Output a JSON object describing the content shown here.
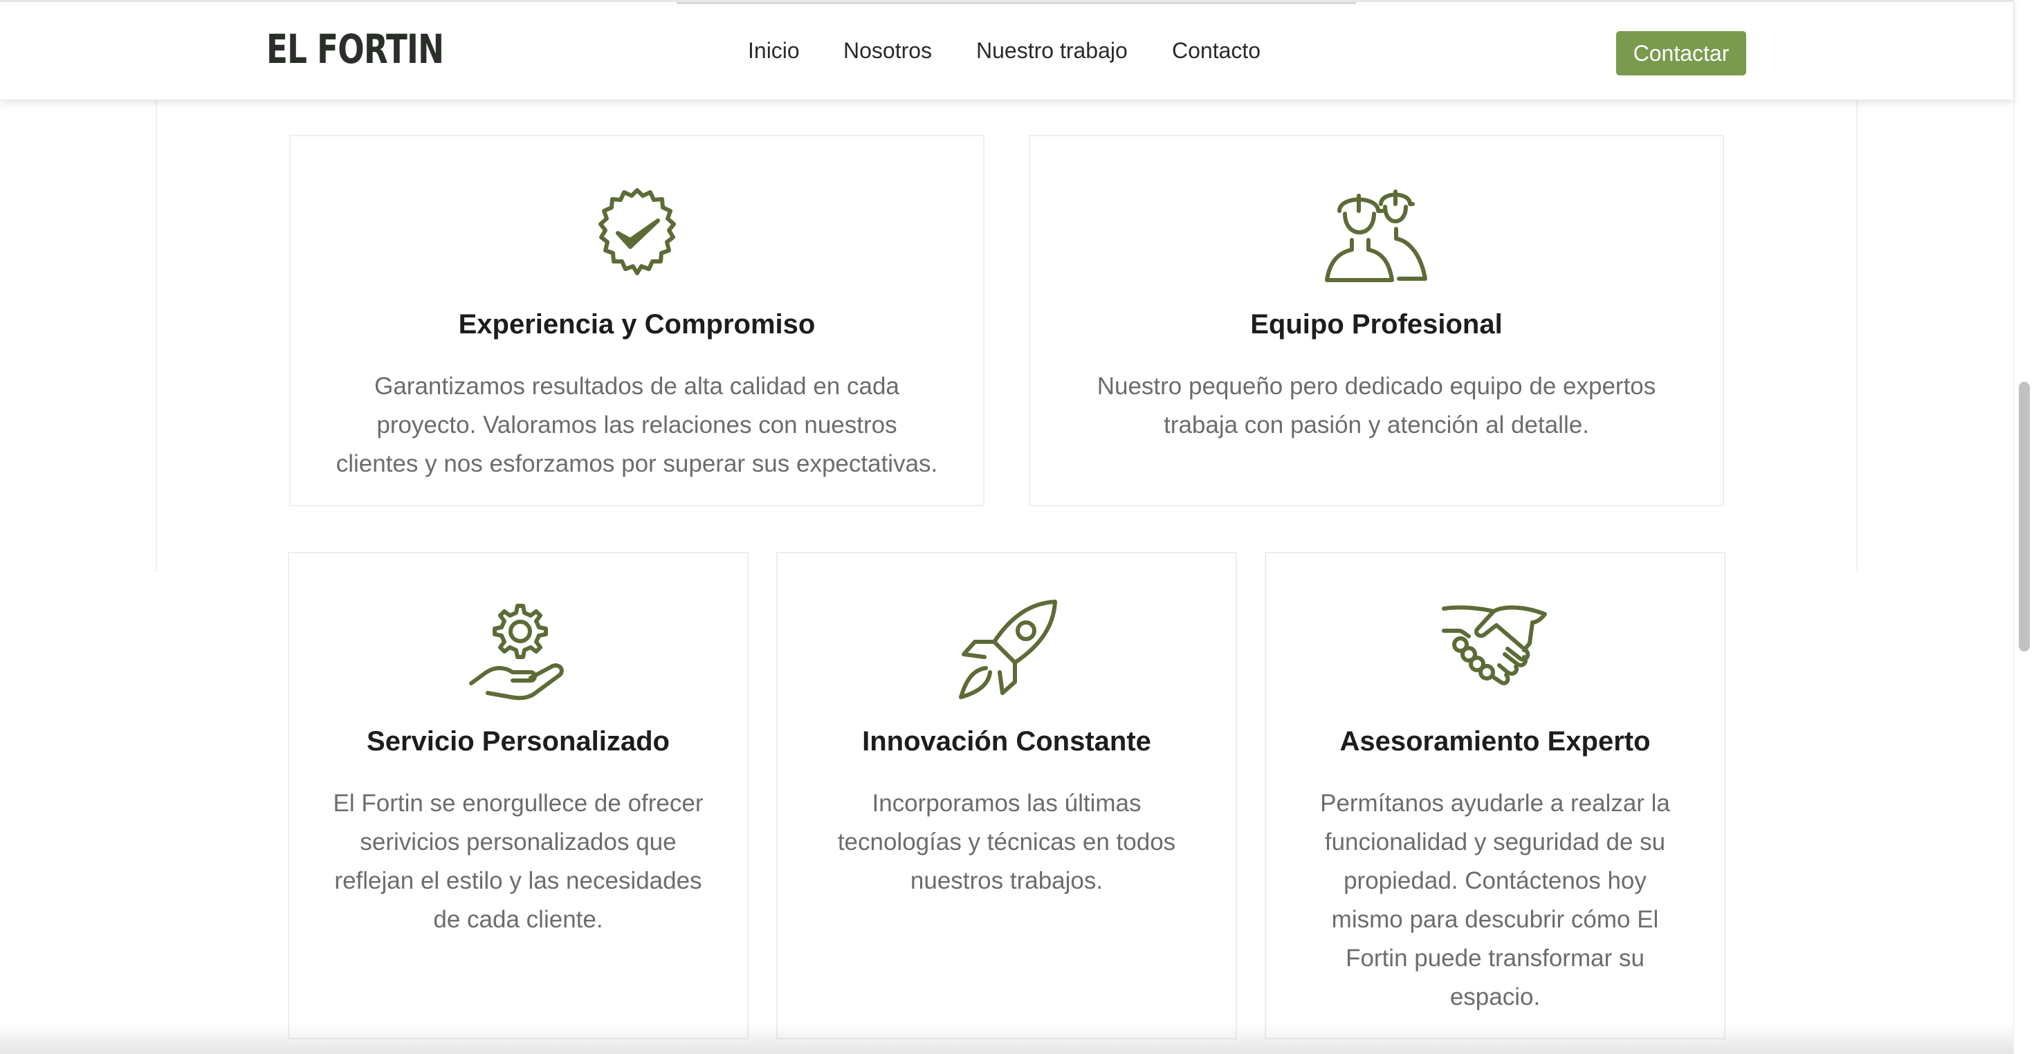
{
  "header": {
    "logo": "EL FORTIN",
    "nav": [
      "Inicio",
      "Nosotros",
      "Nuestro trabajo",
      "Contacto"
    ],
    "cta": "Contactar"
  },
  "colors": {
    "accent": "#7a9a4e",
    "icon": "#5d6b37",
    "heading": "#1d1d1d",
    "body_text": "#6c6c6c"
  },
  "features": [
    {
      "icon": "verified-badge-icon",
      "title": "Experiencia y Compromiso",
      "lines": [
        "Garantizamos resultados de alta calidad en cada",
        "proyecto. Valoramos las relaciones con nuestros",
        "clientes y nos esforzamos por superar sus expectativas."
      ]
    },
    {
      "icon": "workers-helmet-icon",
      "title": "Equipo Profesional",
      "lines": [
        "Nuestro pequeño pero dedicado equipo de expertos",
        "trabaja con pasión y atención al detalle."
      ]
    },
    {
      "icon": "hand-gear-icon",
      "title": "Servicio Personalizado",
      "lines": [
        "El Fortin se enorgullece de ofrecer",
        "serivicios personalizados que",
        "reflejan el estilo y las necesidades",
        "de cada cliente."
      ]
    },
    {
      "icon": "rocket-icon",
      "title": "Innovación Constante",
      "lines": [
        "Incorporamos las últimas",
        "tecnologías y técnicas en todos",
        "nuestros trabajos."
      ]
    },
    {
      "icon": "handshake-icon",
      "title": "Asesoramiento Experto",
      "lines": [
        "Permítanos ayudarle a realzar la",
        "funcionalidad y seguridad de su",
        "propiedad. Contáctenos hoy",
        "mismo para descubrir cómo El",
        "Fortin puede transformar su",
        "espacio."
      ]
    }
  ]
}
